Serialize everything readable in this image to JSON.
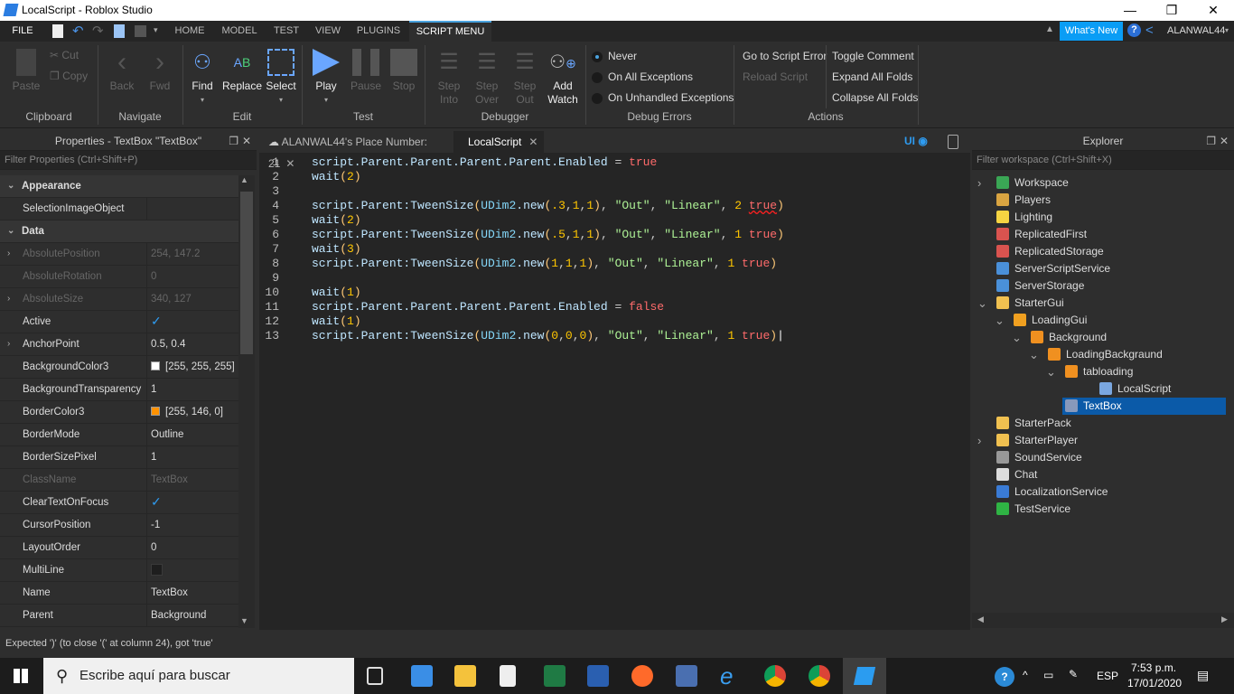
{
  "window": {
    "title": "LocalScript - Roblox Studio",
    "min": "—",
    "max": "❐",
    "close": "✕"
  },
  "menu": {
    "file": "FILE",
    "tabs": [
      "HOME",
      "MODEL",
      "TEST",
      "VIEW",
      "PLUGINS",
      "SCRIPT MENU"
    ],
    "whats_new": "What's New",
    "user": "ALANWAL44",
    "accent": "#0a9df5"
  },
  "ribbon": {
    "clipboard": {
      "paste": "Paste",
      "cut": "Cut",
      "copy": "Copy",
      "label": "Clipboard"
    },
    "navigate": {
      "back": "Back",
      "fwd": "Fwd",
      "label": "Navigate"
    },
    "edit": {
      "find": "Find",
      "replace": "Replace",
      "select": "Select",
      "label": "Edit"
    },
    "test": {
      "play": "Play",
      "pause": "Pause",
      "stop": "Stop",
      "label": "Test"
    },
    "debugger": {
      "step_into": "Step Into",
      "step_over": "Step Over",
      "step_out": "Step Out",
      "add_watch": "Add Watch",
      "label": "Debugger"
    },
    "debug_errors": {
      "never": "Never",
      "all": "On All Exceptions",
      "unhandled": "On Unhandled Exceptions",
      "label": "Debug Errors"
    },
    "actions": {
      "goto_error": "Go to Script Error",
      "reload": "Reload Script",
      "toggle_comment": "Toggle Comment",
      "expand": "Expand All Folds",
      "collapse": "Collapse All Folds",
      "label": "Actions"
    }
  },
  "properties": {
    "title": "Properties - TextBox \"TextBox\"",
    "filter_placeholder": "Filter Properties (Ctrl+Shift+P)",
    "rows": [
      {
        "type": "section",
        "name": "Appearance"
      },
      {
        "name": "SelectionImageObject",
        "value": ""
      },
      {
        "type": "section",
        "name": "Data"
      },
      {
        "name": "AbsolutePosition",
        "value": "254, 147.2",
        "disabled": true,
        "expand": true
      },
      {
        "name": "AbsoluteRotation",
        "value": "0",
        "disabled": true
      },
      {
        "name": "AbsoluteSize",
        "value": "340, 127",
        "disabled": true,
        "expand": true
      },
      {
        "name": "Active",
        "check": true
      },
      {
        "name": "AnchorPoint",
        "value": "0.5, 0.4",
        "expand": true
      },
      {
        "name": "BackgroundColor3",
        "value": "[255, 255, 255]",
        "swatch": "#ffffff"
      },
      {
        "name": "BackgroundTransparency",
        "value": "1"
      },
      {
        "name": "BorderColor3",
        "value": "[255, 146, 0]",
        "swatch": "#ff9200"
      },
      {
        "name": "BorderMode",
        "value": "Outline"
      },
      {
        "name": "BorderSizePixel",
        "value": "1"
      },
      {
        "name": "ClassName",
        "value": "TextBox",
        "disabled": true
      },
      {
        "name": "ClearTextOnFocus",
        "check": true
      },
      {
        "name": "CursorPosition",
        "value": "-1"
      },
      {
        "name": "LayoutOrder",
        "value": "0"
      },
      {
        "name": "MultiLine",
        "check": false
      },
      {
        "name": "Name",
        "value": "TextBox"
      },
      {
        "name": "Parent",
        "value": "Background"
      }
    ]
  },
  "editor": {
    "tabs": [
      {
        "label": "ALANWAL44's Place Number: 21"
      },
      {
        "label": "LocalScript",
        "active": true
      }
    ],
    "ui_label": "UI",
    "lines": [
      [
        [
          "id",
          "script.Parent.Parent.Parent.Parent.Enabled "
        ],
        [
          "op",
          "= "
        ],
        [
          "bool",
          "true"
        ]
      ],
      [
        [
          "id",
          "wait"
        ],
        [
          "p",
          "("
        ],
        [
          "num",
          "2"
        ],
        [
          "p",
          ")"
        ]
      ],
      [],
      [
        [
          "id",
          "script.Parent:TweenSize"
        ],
        [
          "p",
          "("
        ],
        [
          "b",
          "UDim2"
        ],
        [
          "id",
          ".new"
        ],
        [
          "p",
          "("
        ],
        [
          "num",
          ".3"
        ],
        [
          "op",
          ","
        ],
        [
          "num",
          "1"
        ],
        [
          "op",
          ","
        ],
        [
          "num",
          "1"
        ],
        [
          "p",
          ")"
        ],
        [
          "op",
          ", "
        ],
        [
          "str",
          "\"Out\""
        ],
        [
          "op",
          ", "
        ],
        [
          "str",
          "\"Linear\""
        ],
        [
          "op",
          ", "
        ],
        [
          "num",
          "2 "
        ],
        [
          "err",
          "true"
        ],
        [
          "p",
          ")"
        ]
      ],
      [
        [
          "id",
          "wait"
        ],
        [
          "p",
          "("
        ],
        [
          "num",
          "2"
        ],
        [
          "p",
          ")"
        ]
      ],
      [
        [
          "id",
          "script.Parent:TweenSize"
        ],
        [
          "p",
          "("
        ],
        [
          "b",
          "UDim2"
        ],
        [
          "id",
          ".new"
        ],
        [
          "p",
          "("
        ],
        [
          "num",
          ".5"
        ],
        [
          "op",
          ","
        ],
        [
          "num",
          "1"
        ],
        [
          "op",
          ","
        ],
        [
          "num",
          "1"
        ],
        [
          "p",
          ")"
        ],
        [
          "op",
          ", "
        ],
        [
          "str",
          "\"Out\""
        ],
        [
          "op",
          ", "
        ],
        [
          "str",
          "\"Linear\""
        ],
        [
          "op",
          ", "
        ],
        [
          "num",
          "1 "
        ],
        [
          "bool",
          "true"
        ],
        [
          "p",
          ")"
        ]
      ],
      [
        [
          "id",
          "wait"
        ],
        [
          "p",
          "("
        ],
        [
          "num",
          "3"
        ],
        [
          "p",
          ")"
        ]
      ],
      [
        [
          "id",
          "script.Parent:TweenSize"
        ],
        [
          "p",
          "("
        ],
        [
          "b",
          "UDim2"
        ],
        [
          "id",
          ".new"
        ],
        [
          "p",
          "("
        ],
        [
          "num",
          "1"
        ],
        [
          "op",
          ","
        ],
        [
          "num",
          "1"
        ],
        [
          "op",
          ","
        ],
        [
          "num",
          "1"
        ],
        [
          "p",
          ")"
        ],
        [
          "op",
          ", "
        ],
        [
          "str",
          "\"Out\""
        ],
        [
          "op",
          ", "
        ],
        [
          "str",
          "\"Linear\""
        ],
        [
          "op",
          ", "
        ],
        [
          "num",
          "1 "
        ],
        [
          "bool",
          "true"
        ],
        [
          "p",
          ")"
        ]
      ],
      [],
      [
        [
          "id",
          "wait"
        ],
        [
          "p",
          "("
        ],
        [
          "num",
          "1"
        ],
        [
          "p",
          ")"
        ]
      ],
      [
        [
          "id",
          "script.Parent.Parent.Parent.Parent.Enabled "
        ],
        [
          "op",
          "= "
        ],
        [
          "bool",
          "false"
        ]
      ],
      [
        [
          "id",
          "wait"
        ],
        [
          "p",
          "("
        ],
        [
          "num",
          "1"
        ],
        [
          "p",
          ")"
        ]
      ],
      [
        [
          "id",
          "script.Parent:TweenSize"
        ],
        [
          "p",
          "("
        ],
        [
          "b",
          "UDim2"
        ],
        [
          "id",
          ".new"
        ],
        [
          "p",
          "("
        ],
        [
          "num",
          "0"
        ],
        [
          "op",
          ","
        ],
        [
          "num",
          "0"
        ],
        [
          "op",
          ","
        ],
        [
          "num",
          "0"
        ],
        [
          "p",
          ")"
        ],
        [
          "op",
          ", "
        ],
        [
          "str",
          "\"Out\""
        ],
        [
          "op",
          ", "
        ],
        [
          "str",
          "\"Linear\""
        ],
        [
          "op",
          ", "
        ],
        [
          "num",
          "1 "
        ],
        [
          "bool",
          "true"
        ],
        [
          "p",
          ")"
        ]
      ]
    ]
  },
  "explorer": {
    "title": "Explorer",
    "filter_placeholder": "Filter workspace (Ctrl+Shift+X)",
    "items": [
      {
        "label": "Workspace",
        "depth": 0,
        "arrow": "right",
        "icon": "#3aa655"
      },
      {
        "label": "Players",
        "depth": 0,
        "icon": "#d9a441"
      },
      {
        "label": "Lighting",
        "depth": 0,
        "icon": "#f5d442"
      },
      {
        "label": "ReplicatedFirst",
        "depth": 0,
        "icon": "#d9534f"
      },
      {
        "label": "ReplicatedStorage",
        "depth": 0,
        "icon": "#d9534f"
      },
      {
        "label": "ServerScriptService",
        "depth": 0,
        "icon": "#4a90d9"
      },
      {
        "label": "ServerStorage",
        "depth": 0,
        "icon": "#4a90d9"
      },
      {
        "label": "StarterGui",
        "depth": 0,
        "arrow": "down",
        "icon": "#f0c050"
      },
      {
        "label": "LoadingGui",
        "depth": 1,
        "arrow": "down",
        "icon": "#f0a020"
      },
      {
        "label": "Background",
        "depth": 2,
        "arrow": "down",
        "icon": "#f09020"
      },
      {
        "label": "LoadingBackgraund",
        "depth": 3,
        "arrow": "down",
        "icon": "#f09020"
      },
      {
        "label": "tabloading",
        "depth": 4,
        "arrow": "down",
        "icon": "#f09020"
      },
      {
        "label": "LocalScript",
        "depth": 6,
        "icon": "#7aa7e0"
      },
      {
        "label": "TextBox",
        "depth": 4,
        "icon": "#8899bb",
        "selected": true
      },
      {
        "label": "StarterPack",
        "depth": 0,
        "icon": "#f0c050"
      },
      {
        "label": "StarterPlayer",
        "depth": 0,
        "arrow": "right",
        "icon": "#f0c050"
      },
      {
        "label": "SoundService",
        "depth": 0,
        "icon": "#999999"
      },
      {
        "label": "Chat",
        "depth": 0,
        "icon": "#dddddd"
      },
      {
        "label": "LocalizationService",
        "depth": 0,
        "icon": "#3a7bd5"
      },
      {
        "label": "TestService",
        "depth": 0,
        "icon": "#2fb344"
      }
    ]
  },
  "status": {
    "message": "Expected ')' (to close '(' at column 24), got 'true'"
  },
  "taskbar": {
    "search_placeholder": "Escribe aquí para buscar",
    "lang": "ESP",
    "time": "7:53 p.m.",
    "date": "17/01/2020"
  }
}
